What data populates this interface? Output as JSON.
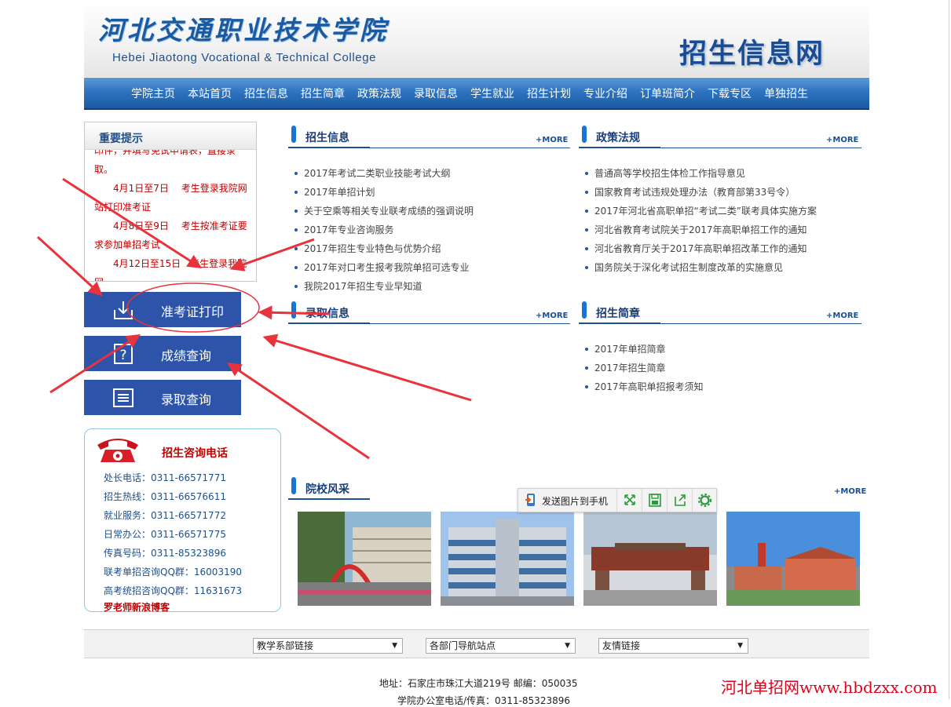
{
  "header": {
    "college_cn": "河北交通职业技术学院",
    "college_en": "Hebei Jiaotong Vocational & Technical College",
    "site_title": "招生信息网"
  },
  "nav": {
    "items": [
      "学院主页",
      "本站首页",
      "招生信息",
      "招生简章",
      "政策法规",
      "录取信息",
      "学生就业",
      "招生计划",
      "专业介绍",
      "订单班简介",
      "下载专区",
      "单独招生"
    ]
  },
  "notice": {
    "title": "重要提示",
    "lines": [
      "印件，并填写免试申请表，直接录",
      "取。",
      "　　4月1日至7日　 考生登录我院网",
      "站打印准考证",
      "　　4月8日至9日　 考生按准考证要",
      "求参加单招考试",
      "　　4月12日至15日　考生登录我院网"
    ]
  },
  "query_buttons": [
    {
      "label": "准考证打印",
      "icon": "download-icon"
    },
    {
      "label": "成绩查询",
      "icon": "question-icon"
    },
    {
      "label": "录取查询",
      "icon": "list-icon"
    }
  ],
  "phone": {
    "title": "招生咨询电话",
    "icon": "telephone-icon",
    "entries": [
      {
        "label": "处长电话：",
        "value": "0311-66571771"
      },
      {
        "label": "招生热线：",
        "value": "0311-66576611"
      },
      {
        "label": "就业服务：",
        "value": "0311-66571772"
      },
      {
        "label": "日常办公：",
        "value": "0311-66571775"
      },
      {
        "label": "传真号码：",
        "value": "0311-85323896"
      },
      {
        "label": "联考单招咨询QQ群：",
        "value": "16003190"
      },
      {
        "label": "高考统招咨询QQ群：",
        "value": "11631673"
      }
    ],
    "blog": "罗老师新浪博客"
  },
  "more_label": "+MORE",
  "sections": {
    "zhaosheng_info": {
      "title": "招生信息",
      "items": [
        "2017年考试二类职业技能考试大纲",
        "2017年单招计划",
        "关于空乘等相关专业联考成绩的强调说明",
        "2017年专业咨询服务",
        "2017年招生专业特色与优势介绍",
        "2017年对口考生报考我院单招可选专业",
        "我院2017年招生专业早知道"
      ]
    },
    "policy": {
      "title": "政策法规",
      "items": [
        "普通高等学校招生体检工作指导意见",
        "国家教育考试违规处理办法（教育部第33号令）",
        "2017年河北省高职单招“考试二类”联考具体实施方案",
        "河北省教育考试院关于2017年高职单招工作的通知",
        "河北省教育厅关于2017年高职单招改革工作的通知",
        "国务院关于深化考试招生制度改革的实施意见"
      ]
    },
    "admission": {
      "title": "录取信息",
      "items": []
    },
    "brochure": {
      "title": "招生简章",
      "items": [
        "2017年单招简章",
        "2017年招生简章",
        "2017年高职单招报考须知"
      ]
    },
    "campus": {
      "title": "院校风采"
    }
  },
  "toolbar": {
    "send_label": "发送图片到手机"
  },
  "footer": {
    "selects": [
      "教学系部链接",
      "各部门导航站点",
      "友情链接"
    ],
    "address": "地址：石家庄市珠江大道219号  邮编：050035",
    "address2": "学院办公室电话/传真：0311-85323896",
    "watermark": "河北单招网www.hbdzxx.com"
  },
  "colors": {
    "nav_blue": "#2f74c0",
    "button_blue": "#2d54a8",
    "section_title": "#1a3e7a",
    "accent_red": "#c00000",
    "arrow_red": "#e8323c"
  }
}
